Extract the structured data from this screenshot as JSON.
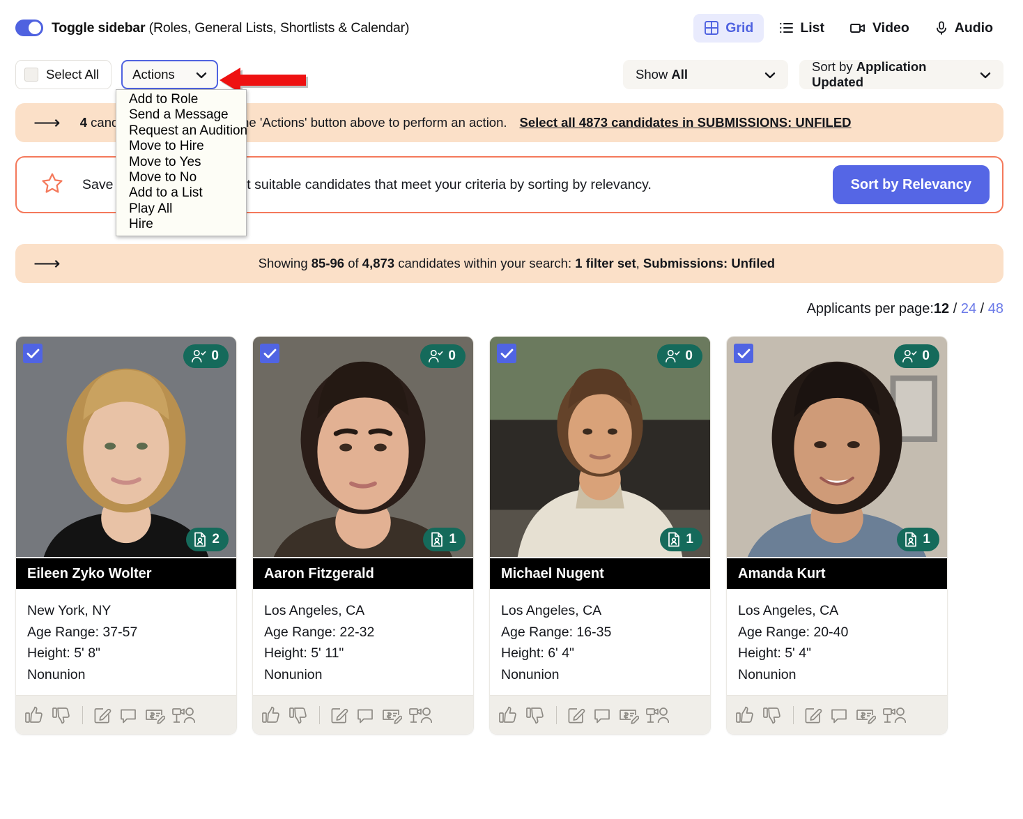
{
  "header": {
    "toggle_bold": "Toggle sidebar",
    "toggle_rest": " (Roles, General Lists, Shortlists & Calendar)",
    "view_modes": [
      {
        "label": "Grid",
        "icon": "grid-icon",
        "active": true
      },
      {
        "label": "List",
        "icon": "list-icon",
        "active": false
      },
      {
        "label": "Video",
        "icon": "video-icon",
        "active": false
      },
      {
        "label": "Audio",
        "icon": "microphone-icon",
        "active": false
      }
    ]
  },
  "toolbar": {
    "select_all_label": "Select All",
    "actions_label": "Actions",
    "show_prefix": "Show ",
    "show_value": "All",
    "sort_prefix": "Sort by ",
    "sort_value": "Application Updated"
  },
  "actions_menu": {
    "items": [
      "Add to Role",
      "Send a Message",
      "Request an Audition",
      "Move to Hire",
      "Move to Yes",
      "Move to No",
      "Add to a List",
      "Play All",
      "Hire"
    ]
  },
  "selected_banner": {
    "count": "4",
    "text": " candidates selected. Use the 'Actions' button above to perform an action.",
    "link_pre": "Select all ",
    "link_count": "4873",
    "link_mid": " candidates in ",
    "link_scope": "SUBMISSIONS: UNFILED"
  },
  "relevancy_banner": {
    "text": "Save time and find the most suitable candidates that meet your criteria by sorting by relevancy.",
    "button_label": "Sort by Relevancy"
  },
  "showing_banner": {
    "pre": "Showing ",
    "range": "85-96",
    "mid": " of ",
    "total": "4,873",
    "post": " candidates within your search: ",
    "filter": "1 filter set",
    "comma": ",  ",
    "scope": "Submissions: Unfiled"
  },
  "pagination": {
    "label": "Applicants per page: ",
    "current": "12",
    "options": [
      "24",
      "48"
    ]
  },
  "colors": {
    "accent_blue": "#4f62e0",
    "checkbox_blue": "#5064e3",
    "badge_teal": "#156a5b",
    "banner_orange": "#fbe0c8",
    "relevancy_border": "#f4795b",
    "arrow_red": "#ee1111",
    "namebar_black": "#000000"
  },
  "card_footer_icons": [
    "thumbs-up-icon",
    "thumbs-down-icon",
    "divider",
    "edit-note-icon",
    "comment-icon",
    "payment-edit-icon",
    "audition-camera-icon"
  ],
  "cards": [
    {
      "name": "Eileen Zyko Wolter",
      "location": "New York, NY",
      "age_range": "Age Range: 37-57",
      "height": "Height: 5' 8\"",
      "union": "Nonunion",
      "selected_count": "0",
      "document_count": "2",
      "checked": true,
      "photo": {
        "skin": "#e8c2a6",
        "hair": "#b9904f",
        "bg": "#75787d",
        "top": "#131313"
      }
    },
    {
      "name": "Aaron Fitzgerald",
      "location": "Los Angeles, CA",
      "age_range": "Age Range: 22-32",
      "height": "Height: 5' 11\"",
      "union": "Nonunion",
      "selected_count": "0",
      "document_count": "1",
      "checked": true,
      "photo": {
        "skin": "#e2b193",
        "hair": "#2a1d18",
        "bg": "#6e6a62",
        "top": "#3a3027"
      }
    },
    {
      "name": "Michael Nugent",
      "location": "Los Angeles, CA",
      "age_range": "Age Range: 16-35",
      "height": "Height: 6' 4\"",
      "union": "Nonunion",
      "selected_count": "0",
      "document_count": "1",
      "checked": true,
      "photo": {
        "skin": "#d9a279",
        "hair": "#64432a",
        "bg": "#57524a",
        "top": "#e6e0d2"
      }
    },
    {
      "name": "Amanda Kurt",
      "location": "Los Angeles, CA",
      "age_range": "Age Range: 20-40",
      "height": "Height: 5' 4\"",
      "union": "Nonunion",
      "selected_count": "0",
      "document_count": "1",
      "checked": true,
      "photo": {
        "skin": "#cf9b78",
        "hair": "#241a15",
        "bg": "#c4bcb0",
        "top": "#6b7f96"
      }
    }
  ]
}
